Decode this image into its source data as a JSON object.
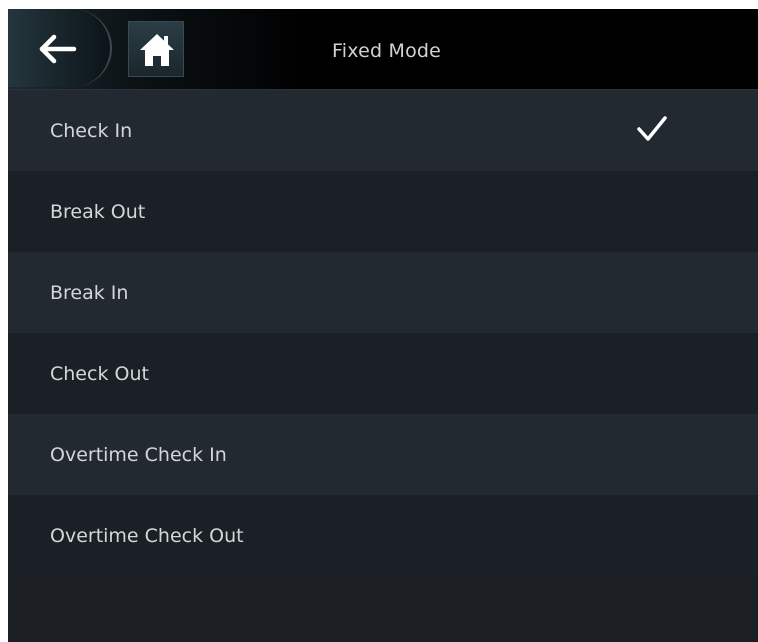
{
  "header": {
    "title": "Fixed Mode",
    "back_icon": "arrow-left-icon",
    "home_icon": "home-icon"
  },
  "modes": {
    "selected_index": 0,
    "items": [
      {
        "label": "Check In",
        "selected": true
      },
      {
        "label": "Break Out",
        "selected": false
      },
      {
        "label": "Break In",
        "selected": false
      },
      {
        "label": "Check Out",
        "selected": false
      },
      {
        "label": "Overtime Check In",
        "selected": false
      },
      {
        "label": "Overtime Check Out",
        "selected": false
      }
    ]
  },
  "colors": {
    "background": "#1b1f24",
    "row_alt": "#232930",
    "header": "#000000",
    "text": "#d3d7da",
    "check": "#ffffff"
  }
}
